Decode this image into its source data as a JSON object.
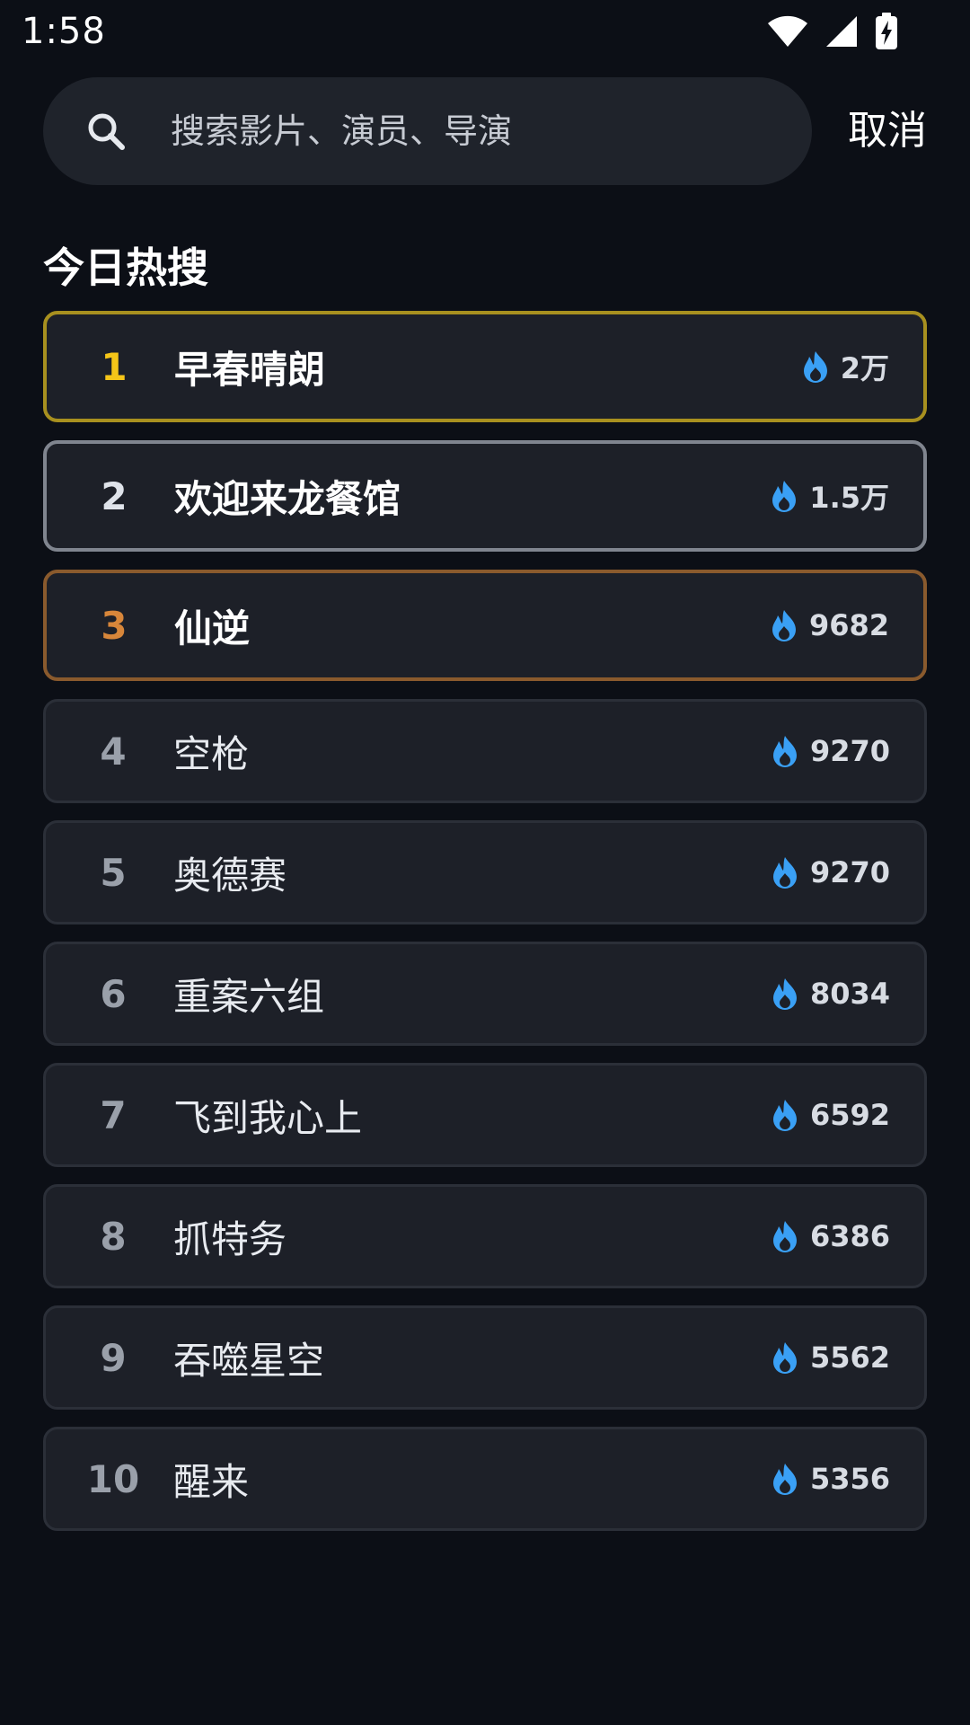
{
  "status_bar": {
    "time": "1:58",
    "icons": [
      "wifi-icon",
      "cell-signal-icon",
      "battery-charging-icon"
    ]
  },
  "search": {
    "placeholder": "搜索影片、演员、导演",
    "value": "",
    "cancel_label": "取消",
    "icon": "search-icon"
  },
  "section": {
    "title": "今日热搜"
  },
  "colors": {
    "background": "#0c0f16",
    "card": "#1d2028",
    "rank1": "#f5c518",
    "rank2": "#dfe3ea",
    "rank3": "#d7863a",
    "flame": "#3aa0f5"
  },
  "hot_list": [
    {
      "rank": "1",
      "title": "早春晴朗",
      "heat": "2万"
    },
    {
      "rank": "2",
      "title": "欢迎来龙餐馆",
      "heat": "1.5万"
    },
    {
      "rank": "3",
      "title": "仙逆",
      "heat": "9682"
    },
    {
      "rank": "4",
      "title": "空枪",
      "heat": "9270"
    },
    {
      "rank": "5",
      "title": "奥德赛",
      "heat": "9270"
    },
    {
      "rank": "6",
      "title": "重案六组",
      "heat": "8034"
    },
    {
      "rank": "7",
      "title": "飞到我心上",
      "heat": "6592"
    },
    {
      "rank": "8",
      "title": "抓特务",
      "heat": "6386"
    },
    {
      "rank": "9",
      "title": "吞噬星空",
      "heat": "5562"
    },
    {
      "rank": "10",
      "title": "醒来",
      "heat": "5356"
    }
  ]
}
